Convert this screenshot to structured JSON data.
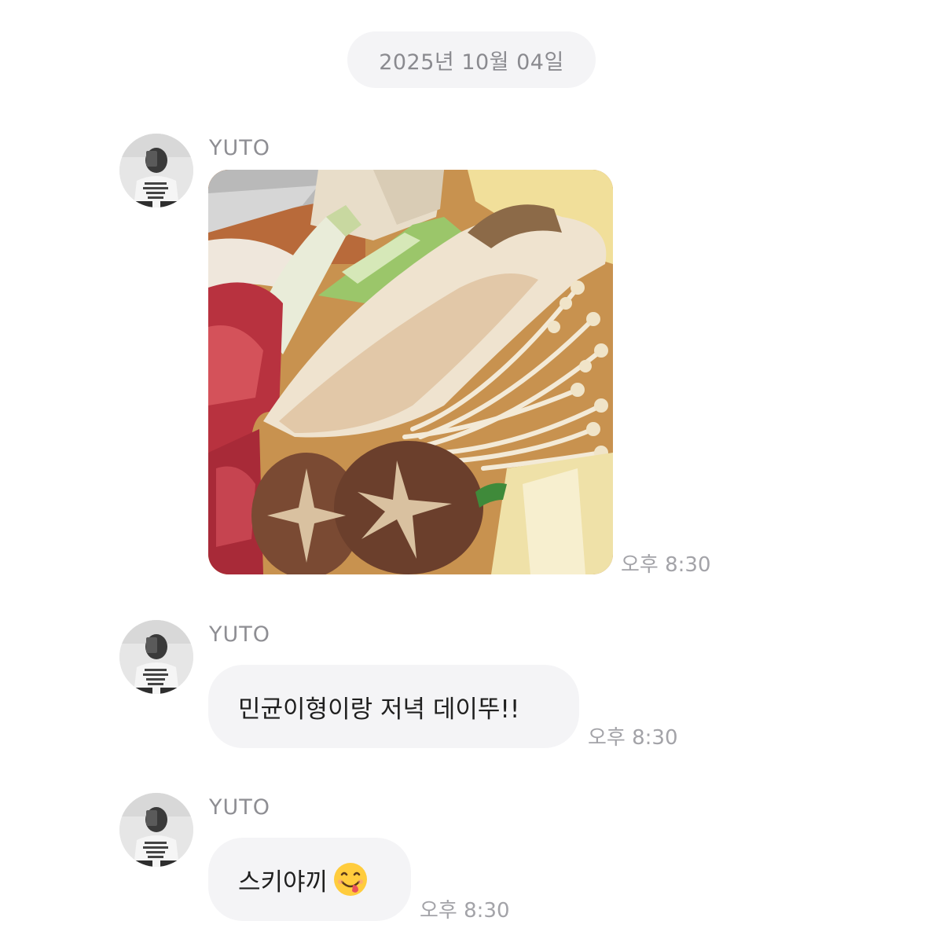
{
  "chat": {
    "date_label": "2025년 10월 04일",
    "messages": [
      {
        "sender": "YUTO",
        "type": "image",
        "image_alt": "food photo",
        "time": "오후 8:30"
      },
      {
        "sender": "YUTO",
        "type": "text",
        "text": "민균이형이랑 저녁 데이뚜!!",
        "time": "오후 8:30"
      },
      {
        "sender": "YUTO",
        "type": "text",
        "text": "스키야끼",
        "emoji": "face-savoring-food-icon",
        "time": "오후 8:30"
      }
    ]
  }
}
